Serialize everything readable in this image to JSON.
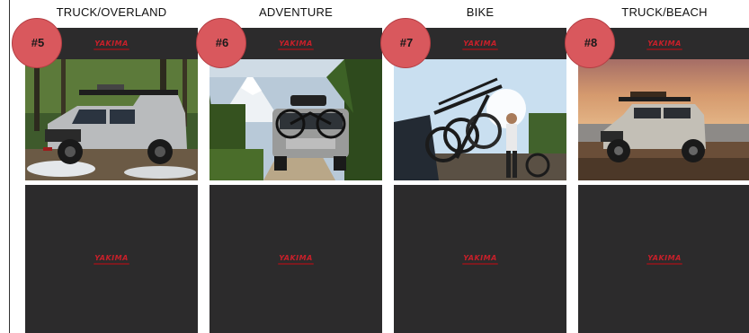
{
  "columns": [
    {
      "title": "TRUCK/OVERLAND",
      "badge": "#5",
      "logo": "YAKIMA",
      "bottom_logo": "YAKIMA",
      "photo": "truck-offroad-forest-photo"
    },
    {
      "title": "ADVENTURE",
      "badge": "#6",
      "logo": "YAKIMA",
      "bottom_logo": "YAKIMA",
      "photo": "suv-with-bikes-mountain-photo"
    },
    {
      "title": "BIKE",
      "badge": "#7",
      "logo": "YAKIMA",
      "bottom_logo": "YAKIMA",
      "photo": "hitch-bike-rack-photo"
    },
    {
      "title": "TRUCK/BEACH",
      "badge": "#8",
      "logo": "YAKIMA",
      "bottom_logo": "YAKIMA",
      "photo": "truck-beach-sunset-photo"
    }
  ],
  "colors": {
    "card": "#2c2b2c",
    "badge": "#d9585d",
    "logo": "#c8202a"
  }
}
